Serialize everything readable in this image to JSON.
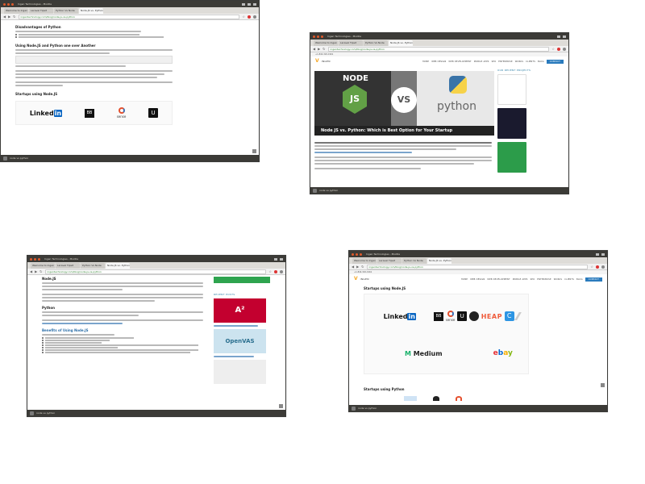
{
  "screenshots": [
    {
      "os": {
        "title": "Ingen Technologies - Mozilla"
      },
      "tabs": [
        "Welcome to Ingen",
        "Laravel Tipsit",
        "Python Vs Node",
        "Node.JS vs. Python"
      ],
      "url": "ingentechnology.com/blog/node-js-vs-python",
      "status": "node vs python",
      "article": {
        "heading_1": "Disadvantages of Python",
        "heading_2": "Using Node.JS and Python one over Another",
        "heading_3": "Startups using Node.JS"
      },
      "logos": [
        "Linked",
        "in",
        "BB",
        "sense",
        "U"
      ]
    },
    {
      "os": {
        "title": "Ingen Technologies - Mozilla"
      },
      "tabs": [
        "Welcome to Ingen",
        "Laravel Tipsit",
        "Python Vs Node",
        "Node.JS vs. Python"
      ],
      "url": "ingentechnology.com/blog/node-js-vs-python",
      "status": "node vs python",
      "contact": "+1-844-320-1961",
      "brand": "INGEN",
      "nav": [
        "HOME",
        "WEB DESIGN",
        "WEB DEVELOPMENT",
        "MOBILE APPS",
        "SEO",
        "ENTERPRISE",
        "WORKS",
        "CLIENTS",
        "BLOG"
      ],
      "contact_button": "CONTACT",
      "hero": {
        "node": "NODE",
        "js": "JS",
        "vs": "VS",
        "python": "python",
        "caption": "Node JS vs. Python: Which is Best Option for Your Startup"
      },
      "sidebar_title": "OUR RECENT PROJECTS"
    },
    {
      "os": {
        "title": "Ingen Technologies - Mozilla"
      },
      "tabs": [
        "Welcome to Ingen",
        "Laravel Tipsit",
        "Python Vs Node",
        "Node.JS vs. Python"
      ],
      "url": "ingentechnology.com/blog/node-js-vs-python",
      "status": "node vs python",
      "article": {
        "heading_1": "Node.JS",
        "heading_2": "Python",
        "heading_3": "Benefits of Using Node.JS"
      },
      "sidebar": {
        "title": "RECENT POSTS",
        "angular": "A²",
        "openvas": "OpenVAS"
      }
    },
    {
      "os": {
        "title": "Ingen Technologies - Mozilla"
      },
      "tabs": [
        "Welcome to Ingen",
        "Laravel Tipsit",
        "Python Vs Node",
        "Node.JS vs. Python"
      ],
      "url": "ingentechnology.com/blog/node-js-vs-python",
      "status": "node vs python",
      "contact": "+1-844-320-1961",
      "brand": "INGEN",
      "nav": [
        "HOME",
        "WEB DESIGN",
        "WEB DEVELOPMENT",
        "MOBILE APPS",
        "SEO",
        "ENTERPRISE",
        "WORKS",
        "CLIENTS",
        "BLOG"
      ],
      "contact_button": "CONTACT",
      "article": {
        "heading_1": "Startups using Node.JS",
        "heading_2": "Startups using Python"
      },
      "logos": {
        "linkedin": "Linked",
        "in": "in",
        "blackbox": "BB",
        "sense": "sense",
        "uber": "U",
        "heap": "HEAP",
        "c": "C",
        "medium": "Medium",
        "ebay_e": "e",
        "ebay_b": "b",
        "ebay_a": "a",
        "ebay_y": "y"
      }
    }
  ]
}
